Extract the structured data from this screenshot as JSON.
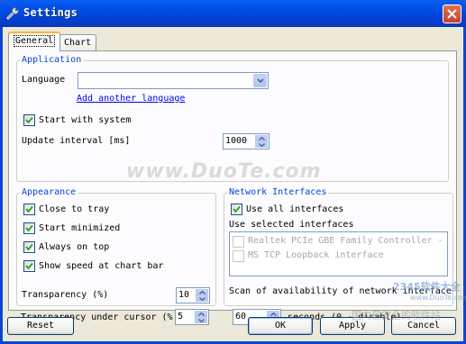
{
  "window": {
    "title": "Settings",
    "title_icon": "wrench-icon",
    "close_icon": "close-icon"
  },
  "tabs": [
    {
      "label": "General",
      "active": true
    },
    {
      "label": "Chart",
      "active": false
    }
  ],
  "application": {
    "group_label": "Application",
    "language_label": "Language",
    "language_value": "",
    "add_language_link": "Add another language",
    "start_with_system": {
      "label": "Start with system",
      "checked": true
    },
    "update_interval_label": "Update interval [ms]",
    "update_interval_value": "1000"
  },
  "appearance": {
    "group_label": "Appearance",
    "close_to_tray": {
      "label": "Close to tray",
      "checked": true
    },
    "start_minimized": {
      "label": "Start minimized",
      "checked": true
    },
    "always_on_top": {
      "label": "Always on top",
      "checked": true
    },
    "show_speed": {
      "label": "Show speed at chart bar",
      "checked": true
    },
    "transparency_label": "Transparency (%)",
    "transparency_value": "10",
    "transparency_cursor_label": "Transparency under cursor (%",
    "transparency_cursor_value": "5"
  },
  "network": {
    "group_label": "Network Interfaces",
    "use_all": {
      "label": "Use all interfaces",
      "checked": true
    },
    "use_selected_label": "Use selected interfaces",
    "interfaces": [
      {
        "label": "Realtek PCIe GBE Family Controller -",
        "checked": false
      },
      {
        "label": "MS TCP Loopback interface",
        "checked": false
      }
    ],
    "scan_label": "Scan of availability of network interface",
    "scan_value": "60",
    "seconds_label": "seconds (0 - disable)"
  },
  "buttons": {
    "reset": "Reset",
    "ok": "OK",
    "apply": "Apply",
    "cancel": "Cancel"
  },
  "watermarks": {
    "main": "www.DuoTe.com",
    "logo": "2345软件大全",
    "logo_url": "www.DuoTe.com",
    "bottom": "国内最安全的软件站"
  },
  "colors": {
    "title_bar": "#0050e6",
    "group_label": "#0046d5",
    "link": "#0000ee",
    "dialog_bg": "#ece9d8"
  }
}
